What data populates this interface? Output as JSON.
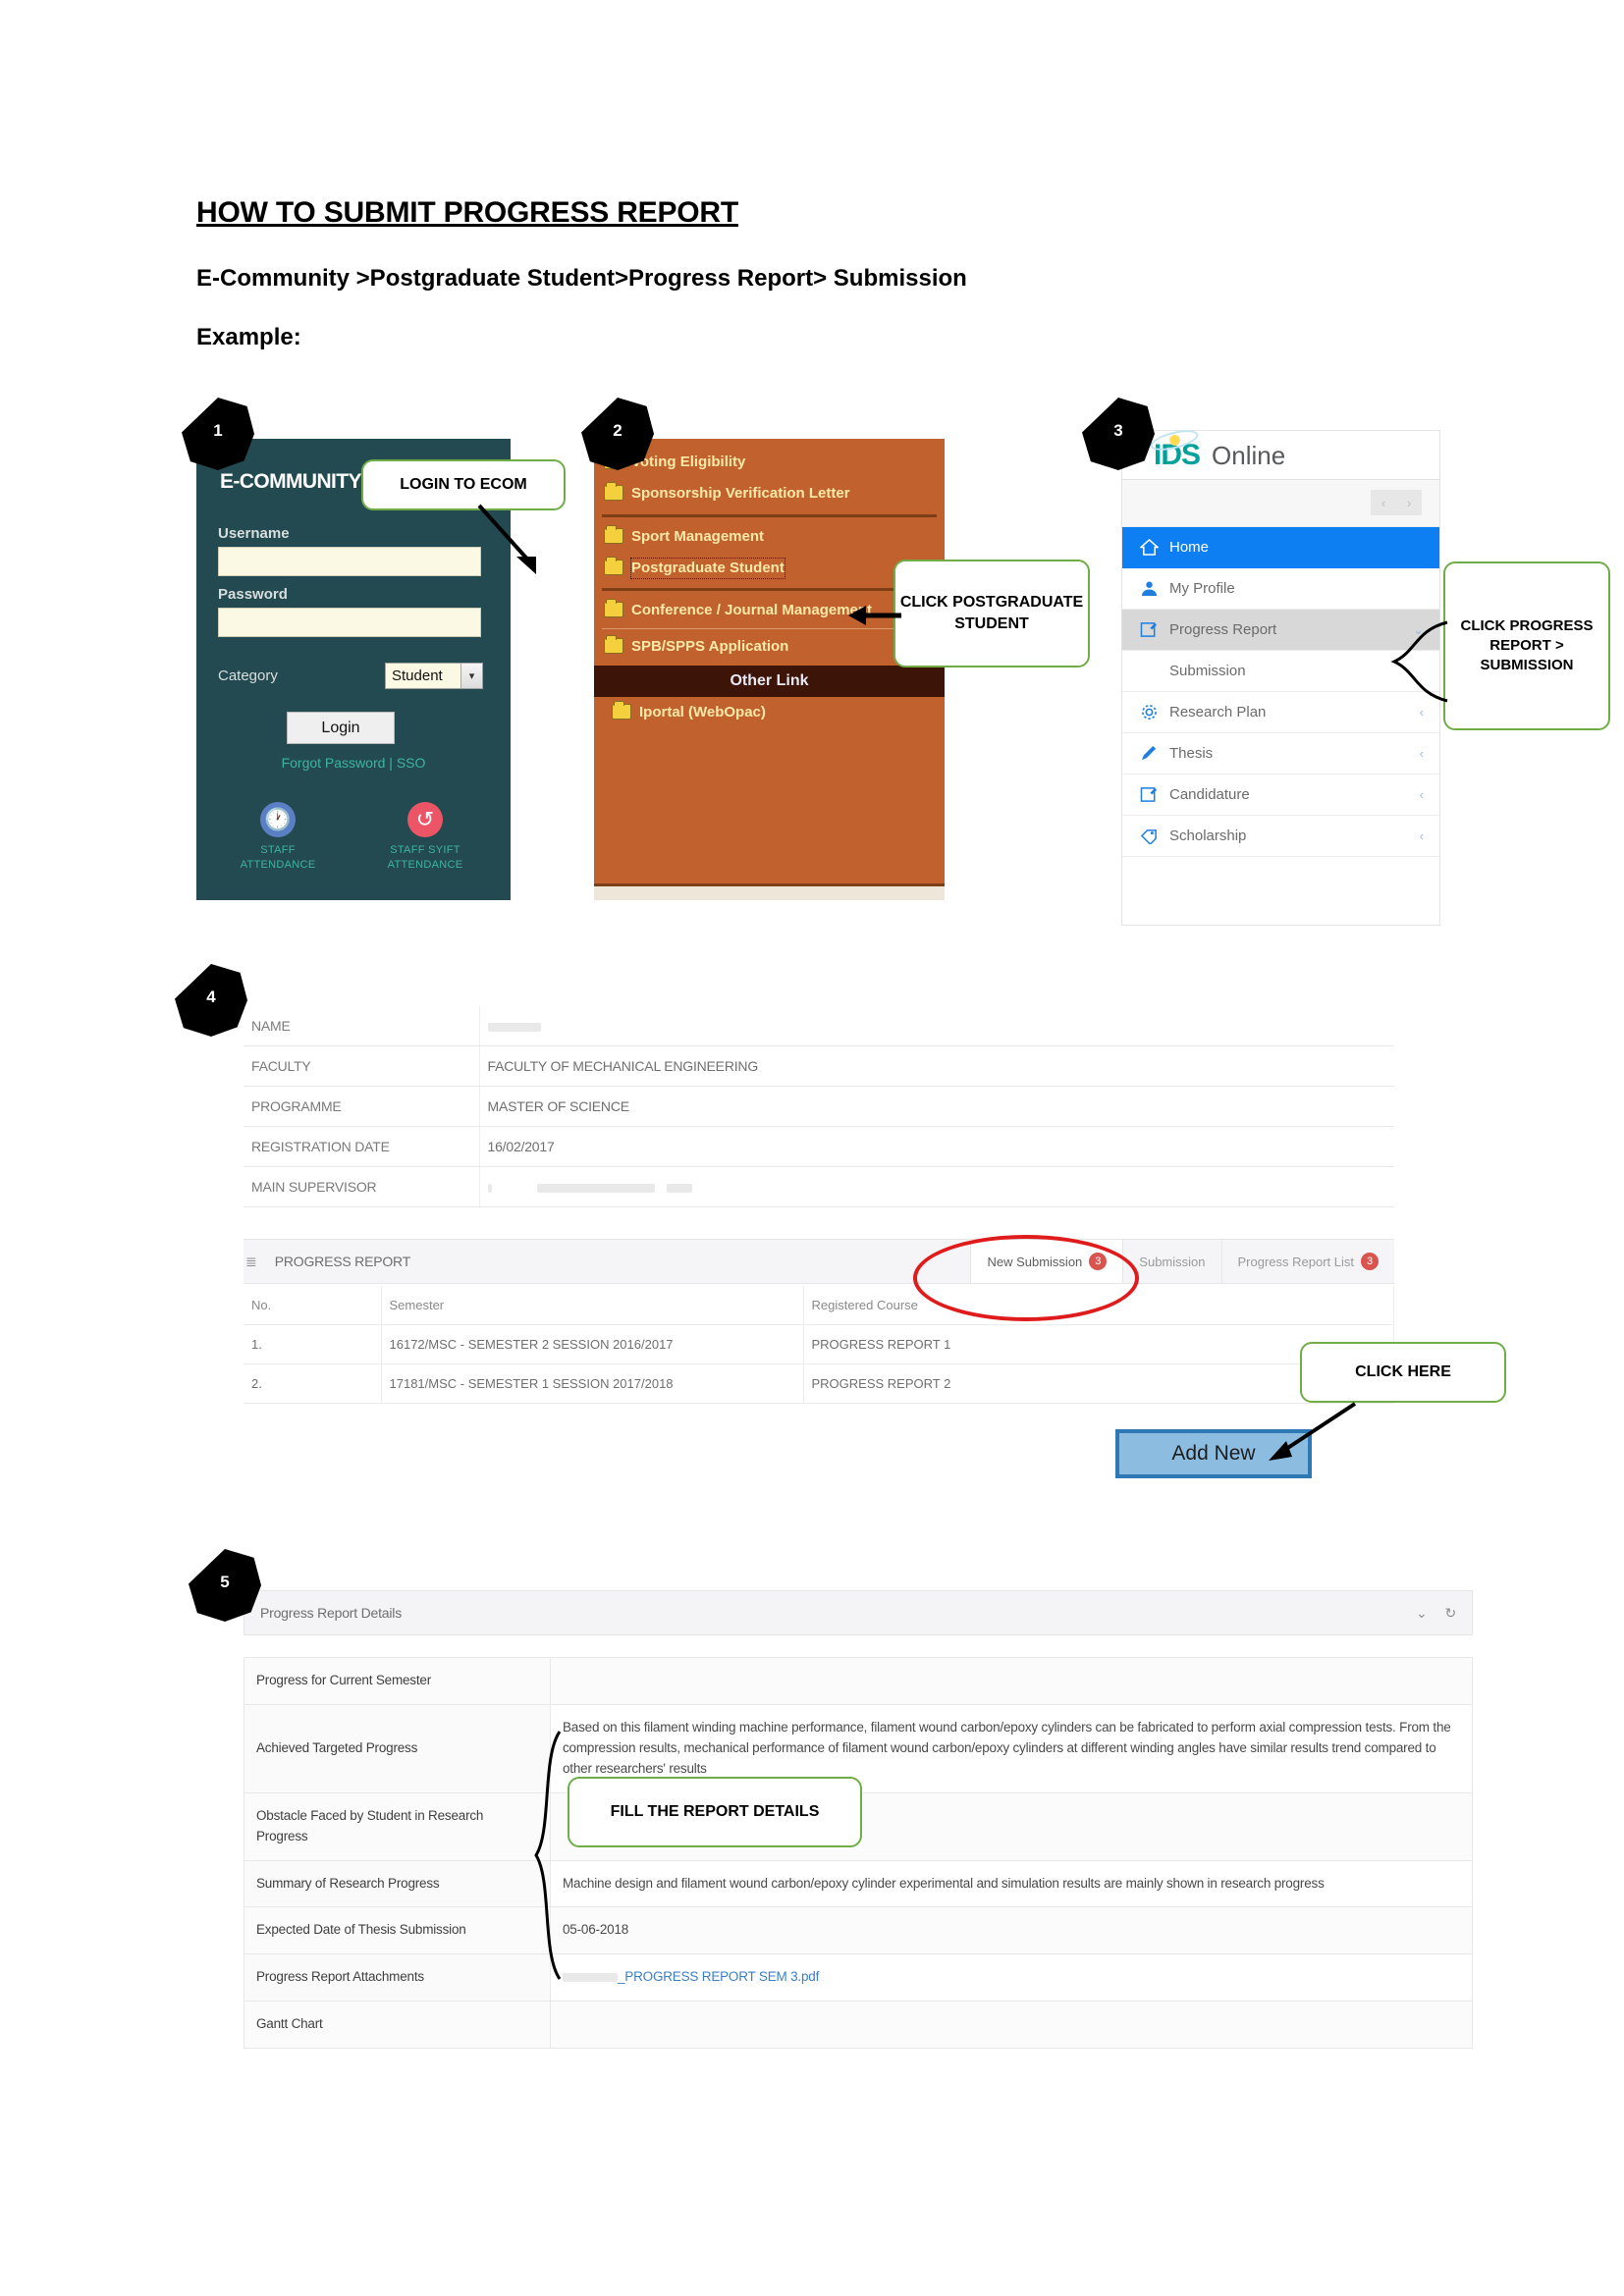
{
  "document": {
    "title": "HOW TO SUBMIT PROGRESS REPORT",
    "breadcrumb": "E-Community >Postgraduate Student>Progress Report> Submission",
    "example_label": "Example:"
  },
  "steps": {
    "one": "1",
    "two": "2",
    "three": "3",
    "four": "4",
    "five": "5"
  },
  "callouts": {
    "login_to_ecom": "LOGIN TO ECOM",
    "click_postgraduate_student": "CLICK POSTGRADUATE STUDENT",
    "click_progress_report_submission": "CLICK PROGRESS REPORT > SUBMISSION",
    "click_here": "CLICK HERE",
    "fill_the_report_details": "FILL THE REPORT DETAILS"
  },
  "login_panel": {
    "logo": "E-COMMUNITY",
    "username_label": "Username",
    "username_value": "",
    "password_label": "Password",
    "password_value": "",
    "category_label": "Category",
    "category_value": "Student",
    "login_button": "Login",
    "forgot_password": "Forgot Password",
    "separator": "|",
    "sso": "SSO",
    "staff_attendance": "STAFF ATTENDANCE",
    "staff_syift_attendance": "STAFF SYIFT ATTENDANCE",
    "colors": {
      "background": "#224a50",
      "field": "#fbf8e3",
      "link": "#3fb3a0"
    }
  },
  "orange_menu": {
    "items": [
      {
        "label": "Voting Eligibility"
      },
      {
        "label": "Sponsorship Verification Letter"
      },
      {
        "label": "Sport Management"
      },
      {
        "label": "Postgraduate Student"
      },
      {
        "label": "Conference / Journal Management"
      },
      {
        "label": "SPB/SPPS Application"
      }
    ],
    "other_link_header": "Other Link",
    "other_link_item": "Iportal (WebOpac)",
    "colors": {
      "background": "#c1622e",
      "text": "#ffe9a8",
      "header": "#3d1508"
    }
  },
  "ids_sidebar": {
    "brand_mark": "IDS",
    "brand_name": "Online",
    "pager_prev": "‹",
    "pager_next": "›",
    "items": [
      {
        "label": "Home",
        "icon": "home-icon",
        "state": "active",
        "chevron": ""
      },
      {
        "label": "My Profile",
        "icon": "user-icon",
        "state": "normal",
        "chevron": ""
      },
      {
        "label": "Progress Report",
        "icon": "edit-square-icon",
        "state": "open",
        "chevron": "⌄"
      },
      {
        "label": "Research Plan",
        "icon": "gear-icon",
        "state": "normal",
        "chevron": "‹"
      },
      {
        "label": "Thesis",
        "icon": "pencil-icon",
        "state": "normal",
        "chevron": "‹"
      },
      {
        "label": "Candidature",
        "icon": "edit-square-icon",
        "state": "normal",
        "chevron": "‹"
      },
      {
        "label": "Scholarship",
        "icon": "tag-icon",
        "state": "normal",
        "chevron": "‹"
      }
    ],
    "submenu": {
      "label": "Submission"
    },
    "colors": {
      "active": "#0d7ff2",
      "open": "#d8d8d8"
    }
  },
  "student_info": {
    "rows": [
      {
        "key": "NAME",
        "value": ""
      },
      {
        "key": "FACULTY",
        "value": "FACULTY OF MECHANICAL ENGINEERING"
      },
      {
        "key": "PROGRAMME",
        "value": "MASTER OF SCIENCE"
      },
      {
        "key": "REGISTRATION DATE",
        "value": "16/02/2017"
      },
      {
        "key": "MAIN SUPERVISOR",
        "value": ""
      }
    ]
  },
  "progress_report_panel": {
    "title": "PROGRESS REPORT",
    "tabs": [
      {
        "label": "New Submission",
        "count": "3",
        "current": true
      },
      {
        "label": "Submission",
        "count": "",
        "current": false
      },
      {
        "label": "Progress Report List",
        "count": "3",
        "current": false
      }
    ],
    "columns": [
      "No.",
      "Semester",
      "Registered Course"
    ],
    "rows": [
      {
        "no": "1.",
        "semester": "16172/MSC - SEMESTER 2 SESSION 2016/2017",
        "course": "PROGRESS REPORT 1"
      },
      {
        "no": "2.",
        "semester": "17181/MSC - SEMESTER 1 SESSION 2017/2018",
        "course": "PROGRESS REPORT 2"
      }
    ],
    "add_new_button": "Add New"
  },
  "report_details": {
    "panel_title": "Progress Report Details",
    "collapse_icon": "⌄",
    "refresh_icon": "↻",
    "rows": [
      {
        "key": "Progress for Current Semester",
        "value": ""
      },
      {
        "key": "Achieved Targeted Progress",
        "value": "Based on this filament winding machine performance, filament wound carbon/epoxy cylinders can be fabricated to perform axial compression tests. From the compression results, mechanical performance of filament wound carbon/epoxy cylinders at different winding angles have similar results trend compared to other researchers' results"
      },
      {
        "key": "Obstacle Faced by Student in Research Progress",
        "value": ""
      },
      {
        "key": "Summary of Research Progress",
        "value": "Machine design and filament wound carbon/epoxy cylinder experimental and simulation results are mainly shown in research progress"
      },
      {
        "key": "Expected Date of Thesis Submission",
        "value": "05-06-2018"
      },
      {
        "key": "Progress Report Attachments",
        "value": "_PROGRESS REPORT SEM 3.pdf",
        "is_link": true
      },
      {
        "key": "Gantt Chart",
        "value": ""
      }
    ]
  }
}
